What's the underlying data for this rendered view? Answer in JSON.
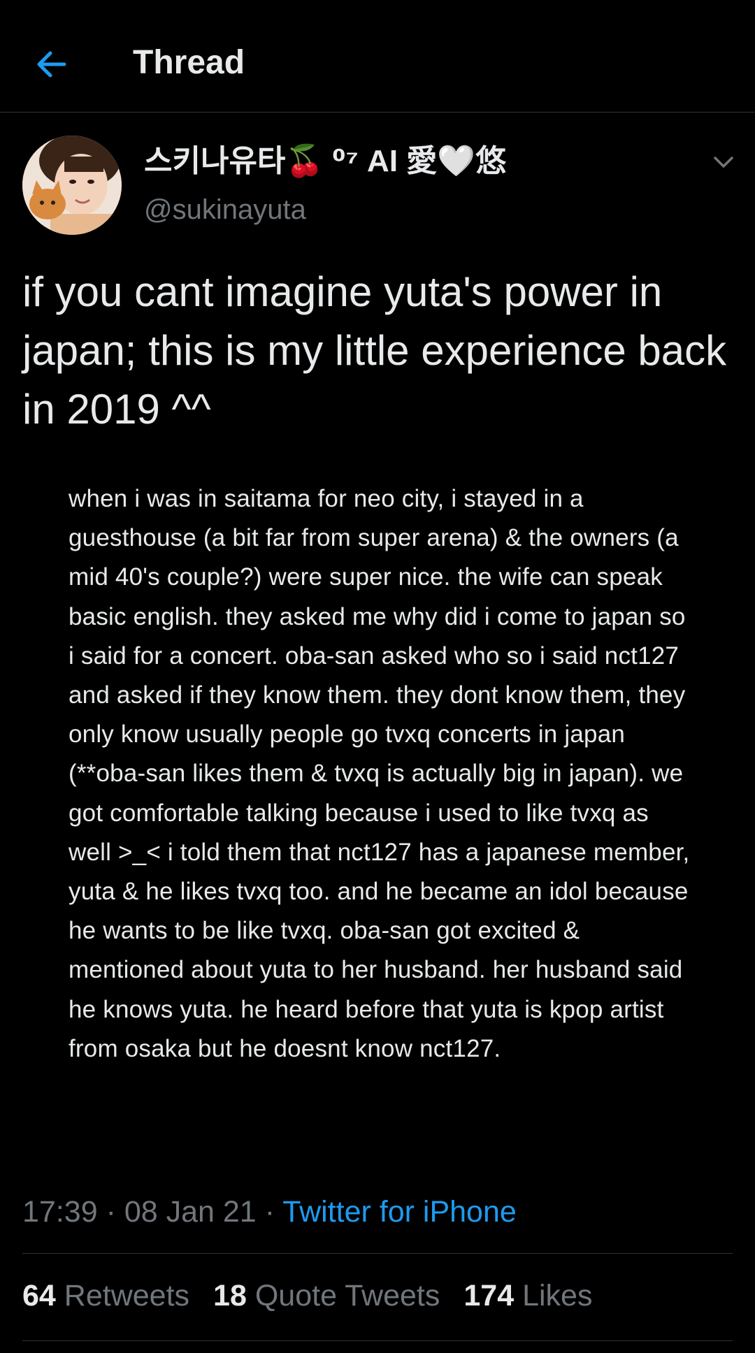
{
  "header": {
    "title": "Thread",
    "back_icon": "arrow-left-icon",
    "accent_color": "#1d9bf0"
  },
  "author": {
    "display_name": "스키나유타🍒 ⁰⁷ AI 愛🤍悠",
    "handle": "@sukinayuta"
  },
  "tweet": {
    "text": "if you cant imagine yuta's power in japan; this is my little experience back in 2019 ^^",
    "image_text": "when i was in saitama for neo city, i stayed in a guesthouse (a bit far from super arena) & the owners (a mid 40's couple?) were super nice. the wife can speak basic english. they asked me why did i come to japan so i said for a concert. oba-san asked who so i said nct127 and asked if they know them. they dont know them, they only know usually people go tvxq concerts in japan (**oba-san likes them & tvxq is actually big in japan). we got comfortable talking because i used to like tvxq as well >_< i told them that nct127 has a japanese member, yuta & he likes tvxq too. and he became an idol because he wants to be like tvxq. oba-san got excited & mentioned about yuta to her husband. her husband said he knows yuta. he heard before that yuta is kpop artist from osaka but he doesnt know nct127.",
    "time": "17:39",
    "date": "08 Jan 21",
    "separator": "·",
    "source": "Twitter for iPhone"
  },
  "stats": {
    "retweets_count": "64",
    "retweets_label": "Retweets",
    "quotes_count": "18",
    "quotes_label": "Quote Tweets",
    "likes_count": "174",
    "likes_label": "Likes"
  }
}
